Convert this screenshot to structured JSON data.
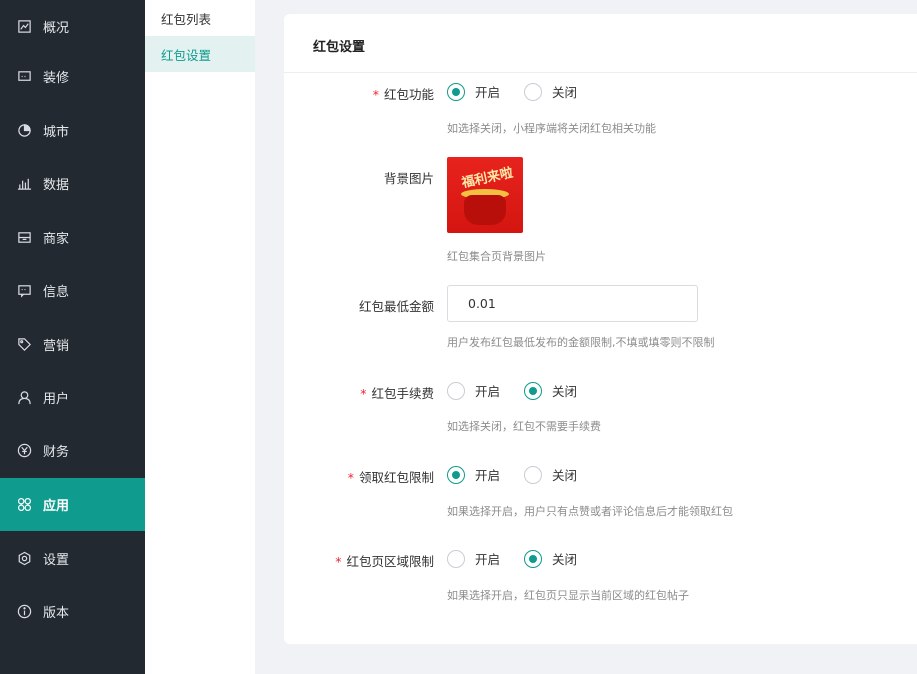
{
  "sidebar": {
    "items": [
      {
        "label": "概况",
        "icon": "overview-icon"
      },
      {
        "label": "装修",
        "icon": "decor-icon"
      },
      {
        "label": "城市",
        "icon": "city-icon"
      },
      {
        "label": "数据",
        "icon": "data-icon"
      },
      {
        "label": "商家",
        "icon": "merchant-icon"
      },
      {
        "label": "信息",
        "icon": "message-icon"
      },
      {
        "label": "营销",
        "icon": "tag-icon"
      },
      {
        "label": "用户",
        "icon": "user-icon"
      },
      {
        "label": "财务",
        "icon": "yen-icon"
      },
      {
        "label": "应用",
        "icon": "apps-icon",
        "active": true
      },
      {
        "label": "设置",
        "icon": "settings-icon"
      },
      {
        "label": "版本",
        "icon": "info-icon"
      }
    ]
  },
  "submenu": {
    "items": [
      {
        "label": "红包列表"
      },
      {
        "label": "红包设置",
        "active": true
      }
    ]
  },
  "panel": {
    "title": "红包设置"
  },
  "form": {
    "redpacket_function": {
      "label": "红包功能",
      "required": true,
      "on": "开启",
      "off": "关闭",
      "selected": "on",
      "hint": "如选择关闭，小程序端将关闭红包相关功能"
    },
    "background_image": {
      "label": "背景图片",
      "hint": "红包集合页背景图片",
      "image_text": "福利来啦"
    },
    "min_amount": {
      "label": "红包最低金额",
      "value": "0.01",
      "hint": "用户发布红包最低发布的金额限制,不填或填零则不限制"
    },
    "fee": {
      "label": "红包手续费",
      "required": true,
      "on": "开启",
      "off": "关闭",
      "selected": "off",
      "hint": "如选择关闭，红包不需要手续费"
    },
    "receive_limit": {
      "label": "领取红包限制",
      "required": true,
      "on": "开启",
      "off": "关闭",
      "selected": "on",
      "hint": "如果选择开启，用户只有点赞或者评论信息后才能领取红包"
    },
    "region_limit": {
      "label": "红包页区域限制",
      "required": true,
      "on": "开启",
      "off": "关闭",
      "selected": "off",
      "hint": "如果选择开启，红包页只显示当前区域的红包帖子"
    }
  },
  "colors": {
    "accent": "#0f9b8e",
    "sidebar_bg": "#222931",
    "required": "#f5222d"
  }
}
